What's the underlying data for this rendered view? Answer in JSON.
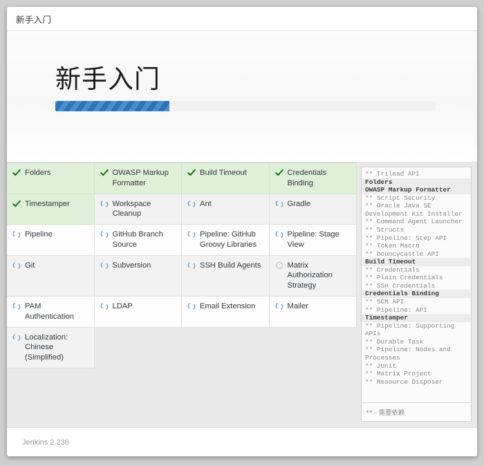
{
  "window": {
    "title": "新手入门"
  },
  "hero": {
    "heading": "新手入门",
    "progress_percent": 30
  },
  "plugins": {
    "columns": [
      [
        {
          "name": "Folders",
          "status": "done"
        },
        {
          "name": "Timestamper",
          "status": "done"
        },
        {
          "name": "Pipeline",
          "status": "installing"
        },
        {
          "name": "Git",
          "status": "installing"
        },
        {
          "name": "PAM Authentication",
          "status": "installing"
        },
        {
          "name": "Localization: Chinese (Simplified)",
          "status": "installing"
        }
      ],
      [
        {
          "name": "OWASP Markup Formatter",
          "status": "done"
        },
        {
          "name": "Workspace Cleanup",
          "status": "installing"
        },
        {
          "name": "GitHub Branch Source",
          "status": "installing"
        },
        {
          "name": "Subversion",
          "status": "installing"
        },
        {
          "name": "LDAP",
          "status": "installing"
        }
      ],
      [
        {
          "name": "Build Timeout",
          "status": "done"
        },
        {
          "name": "Ant",
          "status": "installing"
        },
        {
          "name": "Pipeline: GitHub Groovy Libraries",
          "status": "installing"
        },
        {
          "name": "SSH Build Agents",
          "status": "installing"
        },
        {
          "name": "Email Extension",
          "status": "installing"
        }
      ],
      [
        {
          "name": "Credentials Binding",
          "status": "done"
        },
        {
          "name": "Gradle",
          "status": "installing"
        },
        {
          "name": "Pipeline: Stage View",
          "status": "installing"
        },
        {
          "name": "Matrix Authorization Strategy",
          "status": "pending"
        },
        {
          "name": "Mailer",
          "status": "installing"
        }
      ]
    ],
    "icons": {
      "done": "check-icon",
      "installing": "spinner-icon",
      "pending": "empty-circle-icon"
    }
  },
  "log": {
    "lines": [
      {
        "text": "** Trilead API",
        "type": "dep"
      },
      {
        "text": "Folders",
        "type": "head"
      },
      {
        "text": "OWASP Markup Formatter",
        "type": "head"
      },
      {
        "text": "** Script Security",
        "type": "dep"
      },
      {
        "text": "** Oracle Java SE Development Kit Installer",
        "type": "dep"
      },
      {
        "text": "** Command Agent Launcher",
        "type": "dep"
      },
      {
        "text": "** Structs",
        "type": "dep"
      },
      {
        "text": "** Pipeline: Step API",
        "type": "dep"
      },
      {
        "text": "** Token Macro",
        "type": "dep"
      },
      {
        "text": "** bouncycastle API",
        "type": "dep"
      },
      {
        "text": "Build Timeout",
        "type": "head"
      },
      {
        "text": "** Credentials",
        "type": "dep"
      },
      {
        "text": "** Plain Credentials",
        "type": "dep"
      },
      {
        "text": "** SSH Credentials",
        "type": "dep"
      },
      {
        "text": "Credentials Binding",
        "type": "head"
      },
      {
        "text": "** SCM API",
        "type": "dep"
      },
      {
        "text": "** Pipeline: API",
        "type": "dep"
      },
      {
        "text": "Timestamper",
        "type": "head"
      },
      {
        "text": "** Pipeline: Supporting APIs",
        "type": "dep"
      },
      {
        "text": "** Durable Task",
        "type": "dep"
      },
      {
        "text": "** Pipeline: Nodes and Processes",
        "type": "dep"
      },
      {
        "text": "** JUnit",
        "type": "dep"
      },
      {
        "text": "** Matrix Project",
        "type": "dep"
      },
      {
        "text": "** Resource Disposer",
        "type": "dep"
      }
    ],
    "legend": "**  -  需要依赖"
  },
  "footer": {
    "version": "Jenkins 2.236"
  },
  "colors": {
    "accent": "#3d7fc1",
    "done_background": "#dff0d8",
    "check": "#1b7a1b",
    "spinner": "#7ba7cc"
  }
}
